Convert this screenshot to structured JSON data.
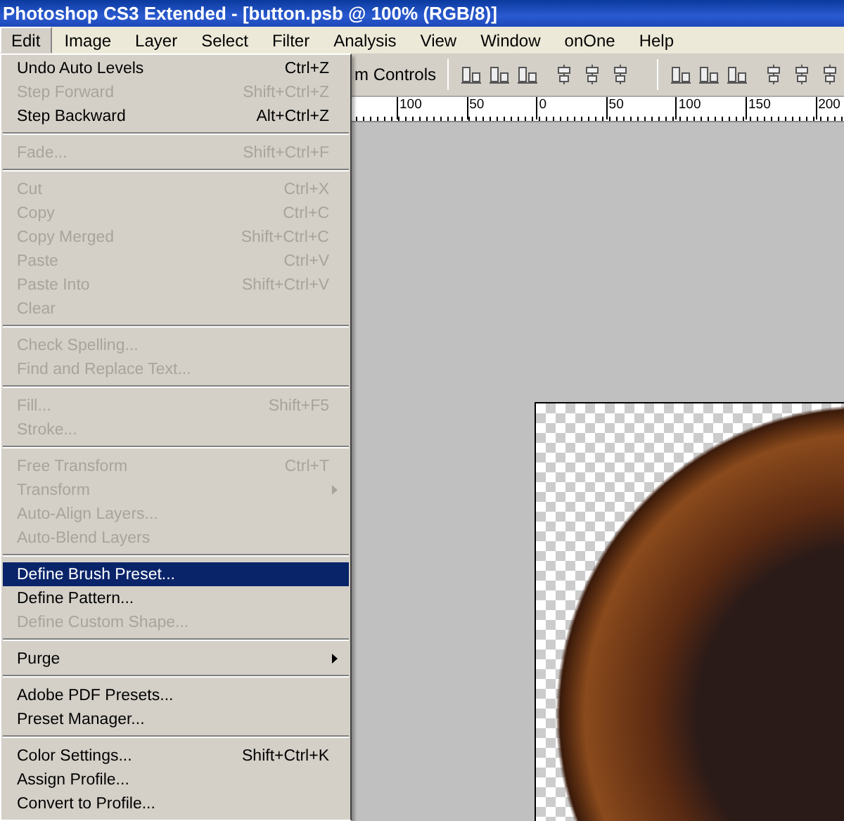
{
  "window": {
    "title": "Photoshop CS3 Extended - [button.psb @ 100% (RGB/8)]"
  },
  "menubar": [
    {
      "label": "Edit",
      "selected": true
    },
    {
      "label": "Image",
      "selected": false
    },
    {
      "label": "Layer",
      "selected": false
    },
    {
      "label": "Select",
      "selected": false
    },
    {
      "label": "Filter",
      "selected": false
    },
    {
      "label": "Analysis",
      "selected": false
    },
    {
      "label": "View",
      "selected": false
    },
    {
      "label": "Window",
      "selected": false
    },
    {
      "label": "onOne",
      "selected": false
    },
    {
      "label": "Help",
      "selected": false
    }
  ],
  "options_bar": {
    "checkbox_label": "m Controls"
  },
  "ruler": {
    "labels": [
      "100",
      "50",
      "0",
      "50",
      "100",
      "150",
      "200"
    ]
  },
  "edit_menu": {
    "groups": [
      [
        {
          "label": "Undo Auto Levels",
          "shortcut": "Ctrl+Z",
          "disabled": false,
          "selected": false,
          "submenu": false
        },
        {
          "label": "Step Forward",
          "shortcut": "Shift+Ctrl+Z",
          "disabled": true,
          "selected": false,
          "submenu": false
        },
        {
          "label": "Step Backward",
          "shortcut": "Alt+Ctrl+Z",
          "disabled": false,
          "selected": false,
          "submenu": false
        }
      ],
      [
        {
          "label": "Fade...",
          "shortcut": "Shift+Ctrl+F",
          "disabled": true,
          "selected": false,
          "submenu": false
        }
      ],
      [
        {
          "label": "Cut",
          "shortcut": "Ctrl+X",
          "disabled": true,
          "selected": false,
          "submenu": false
        },
        {
          "label": "Copy",
          "shortcut": "Ctrl+C",
          "disabled": true,
          "selected": false,
          "submenu": false
        },
        {
          "label": "Copy Merged",
          "shortcut": "Shift+Ctrl+C",
          "disabled": true,
          "selected": false,
          "submenu": false
        },
        {
          "label": "Paste",
          "shortcut": "Ctrl+V",
          "disabled": true,
          "selected": false,
          "submenu": false
        },
        {
          "label": "Paste Into",
          "shortcut": "Shift+Ctrl+V",
          "disabled": true,
          "selected": false,
          "submenu": false
        },
        {
          "label": "Clear",
          "disabled": true,
          "selected": false,
          "submenu": false
        }
      ],
      [
        {
          "label": "Check Spelling...",
          "disabled": true,
          "selected": false,
          "submenu": false
        },
        {
          "label": "Find and Replace Text...",
          "disabled": true,
          "selected": false,
          "submenu": false
        }
      ],
      [
        {
          "label": "Fill...",
          "shortcut": "Shift+F5",
          "disabled": true,
          "selected": false,
          "submenu": false
        },
        {
          "label": "Stroke...",
          "disabled": true,
          "selected": false,
          "submenu": false
        }
      ],
      [
        {
          "label": "Free Transform",
          "shortcut": "Ctrl+T",
          "disabled": true,
          "selected": false,
          "submenu": false
        },
        {
          "label": "Transform",
          "disabled": true,
          "selected": false,
          "submenu": true
        },
        {
          "label": "Auto-Align Layers...",
          "disabled": true,
          "selected": false,
          "submenu": false
        },
        {
          "label": "Auto-Blend Layers",
          "disabled": true,
          "selected": false,
          "submenu": false
        }
      ],
      [
        {
          "label": "Define Brush Preset...",
          "disabled": false,
          "selected": true,
          "submenu": false
        },
        {
          "label": "Define Pattern...",
          "disabled": false,
          "selected": false,
          "submenu": false
        },
        {
          "label": "Define Custom Shape...",
          "disabled": true,
          "selected": false,
          "submenu": false
        }
      ],
      [
        {
          "label": "Purge",
          "disabled": false,
          "selected": false,
          "submenu": true
        }
      ],
      [
        {
          "label": "Adobe PDF Presets...",
          "disabled": false,
          "selected": false,
          "submenu": false
        },
        {
          "label": "Preset Manager...",
          "disabled": false,
          "selected": false,
          "submenu": false
        }
      ],
      [
        {
          "label": "Color Settings...",
          "shortcut": "Shift+Ctrl+K",
          "disabled": false,
          "selected": false,
          "submenu": false
        },
        {
          "label": "Assign Profile...",
          "disabled": false,
          "selected": false,
          "submenu": false
        },
        {
          "label": "Convert to Profile...",
          "disabled": false,
          "selected": false,
          "submenu": false
        }
      ]
    ]
  }
}
